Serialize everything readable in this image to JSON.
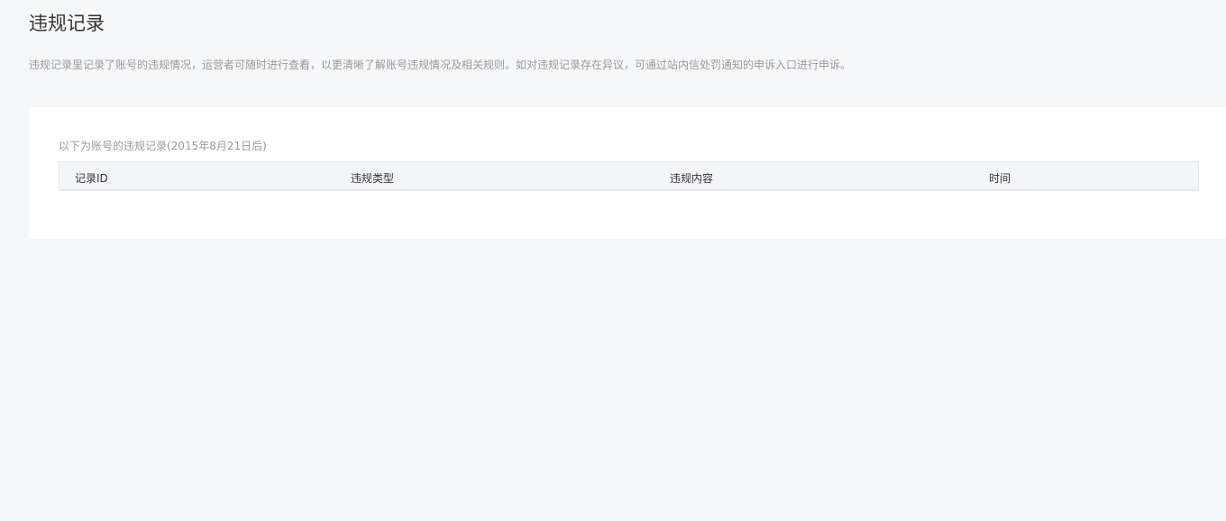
{
  "page": {
    "title": "违规记录",
    "description": "违规记录里记录了账号的违规情况，运营者可随时进行查看，以更清晰了解账号违规情况及相关规则。如对违规记录存在异议，可通过站内信处罚通知的申诉入口进行申诉。"
  },
  "records": {
    "caption": "以下为账号的违规记录(2015年8月21日后)",
    "columns": [
      "记录ID",
      "违规类型",
      "违规内容",
      "时间"
    ],
    "rows": []
  }
}
